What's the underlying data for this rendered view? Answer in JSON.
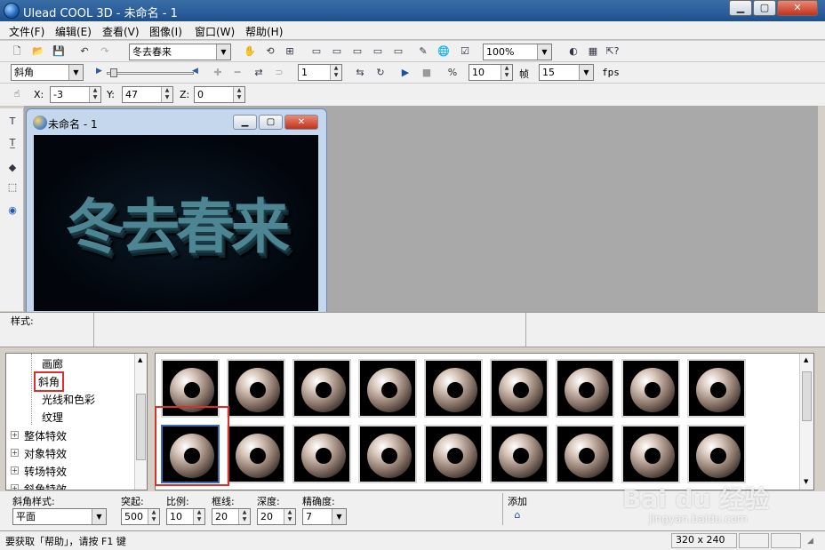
{
  "window": {
    "title": "Ulead COOL 3D - 未命名 - 1",
    "min": "▁",
    "max": "▢",
    "close": "✕"
  },
  "menu": [
    "文件(F)",
    "编辑(E)",
    "查看(V)",
    "图像(I)",
    "窗口(W)",
    "帮助(H)"
  ],
  "toolbar1": {
    "text_select": "冬去春来",
    "zoom": "100%"
  },
  "toolbar2": {
    "effect_select": "斜角",
    "frame_value": "1",
    "speed_value": "10",
    "frame_label": "帧",
    "fps_value": "15",
    "fps_label": "fps"
  },
  "toolbar3": {
    "x_label": "X:",
    "x_value": "-3",
    "y_label": "Y:",
    "y_value": "47",
    "z_label": "Z:",
    "z_value": "0"
  },
  "document": {
    "title": "未命名 - 1",
    "text": "冬去春来"
  },
  "style_panel": {
    "label": "样式:"
  },
  "tree": {
    "items": [
      {
        "label": "画廊",
        "level": 2
      },
      {
        "label": "斜角",
        "level": 2
      },
      {
        "label": "光线和色彩",
        "level": 2
      },
      {
        "label": "纹理",
        "level": 2
      },
      {
        "label": "整体特效",
        "level": 1
      },
      {
        "label": "对象特效",
        "level": 1
      },
      {
        "label": "转场特效",
        "level": 1
      },
      {
        "label": "斜角特效",
        "level": 1
      }
    ]
  },
  "params": {
    "bevel_style_label": "斜角样式:",
    "bevel_style_value": "平面",
    "protrude_label": "突起:",
    "protrude_value": "500",
    "scale_label": "比例:",
    "scale_value": "10",
    "border_label": "框线:",
    "border_value": "20",
    "depth_label": "深度:",
    "depth_value": "20",
    "precision_label": "精确度:",
    "precision_value": "7",
    "add_label": "添加"
  },
  "status": {
    "help": "要获取「帮助」，请按 F1 键",
    "size": "320 x 240"
  },
  "watermark": {
    "brand": "Bai du 经验",
    "url": "jingyan.baidu.com"
  }
}
